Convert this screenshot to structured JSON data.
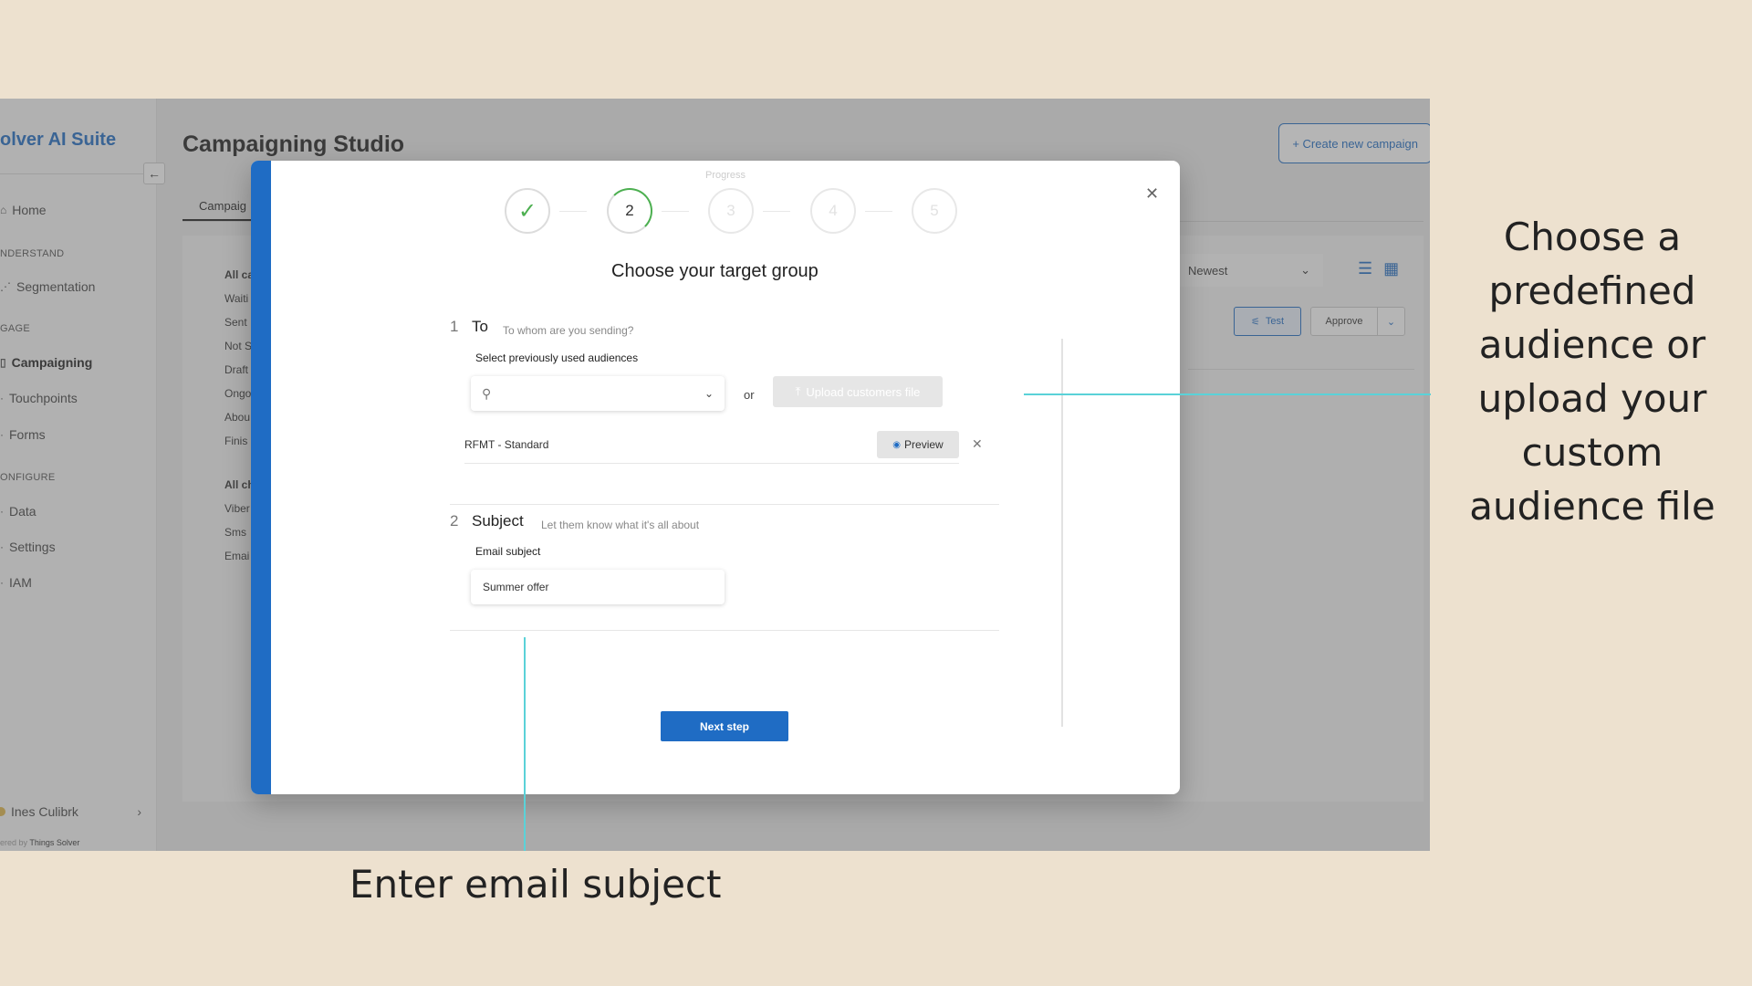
{
  "sidebar": {
    "brand": "olver AI Suite",
    "collapse_icon": "arrow-left-icon",
    "items": [
      {
        "label": "Home",
        "icon": "home-icon"
      },
      {
        "label": "Segmentation",
        "icon": "segmentation-icon"
      },
      {
        "label": "Campaigning",
        "icon": "campaign-icon"
      },
      {
        "label": "Touchpoints",
        "icon": "touchpoints-icon"
      },
      {
        "label": "Forms",
        "icon": "forms-icon"
      },
      {
        "label": "Data",
        "icon": "data-icon"
      },
      {
        "label": "Settings",
        "icon": "settings-icon"
      },
      {
        "label": "IAM",
        "icon": "iam-icon"
      }
    ],
    "sections": [
      "NDERSTAND",
      "GAGE",
      "ONFIGURE"
    ],
    "user_name": "Ines Culibrk",
    "powered_by_prefix": "ered by",
    "powered_by_brand": "Things Solver"
  },
  "main": {
    "title": "Campaigning Studio",
    "create_button": "+ Create new campaign",
    "active_tab": "Campaig",
    "filters_status": [
      "All ca",
      "Waiti",
      "Sent",
      "Not S",
      "Draft",
      "Ongo",
      "Abou",
      "Finis"
    ],
    "filters_channel": [
      "All ch",
      "Viber",
      "Sms",
      "Emai"
    ],
    "sort_value": "Newest",
    "test_button": "Test",
    "approve_button": "Approve"
  },
  "modal": {
    "progress_label": "Progress",
    "steps": [
      "✓",
      "2",
      "3",
      "4",
      "5"
    ],
    "current_step": 2,
    "title": "Choose your target group",
    "section1": {
      "number": "1",
      "title": "To",
      "hint": "To whom are you sending?",
      "field_label": "Select previously used audiences",
      "search_placeholder": "",
      "or_label": "or",
      "upload_button": "Upload customers file",
      "audience_name": "RFMT - Standard",
      "preview_button": "Preview"
    },
    "section2": {
      "number": "2",
      "title": "Subject",
      "hint": "Let them know what it's all about",
      "field_label": "Email subject",
      "subject_value": "Summer offer"
    },
    "next_button": "Next step"
  },
  "callouts": {
    "right": "Choose a predefined audience or upload your custom audience file",
    "bottom": "Enter email subject"
  },
  "colors": {
    "background": "#ede1cf",
    "accent_blue": "#1f6cc4",
    "callout_line": "#5ad2d8",
    "success_green": "#4caf50"
  }
}
